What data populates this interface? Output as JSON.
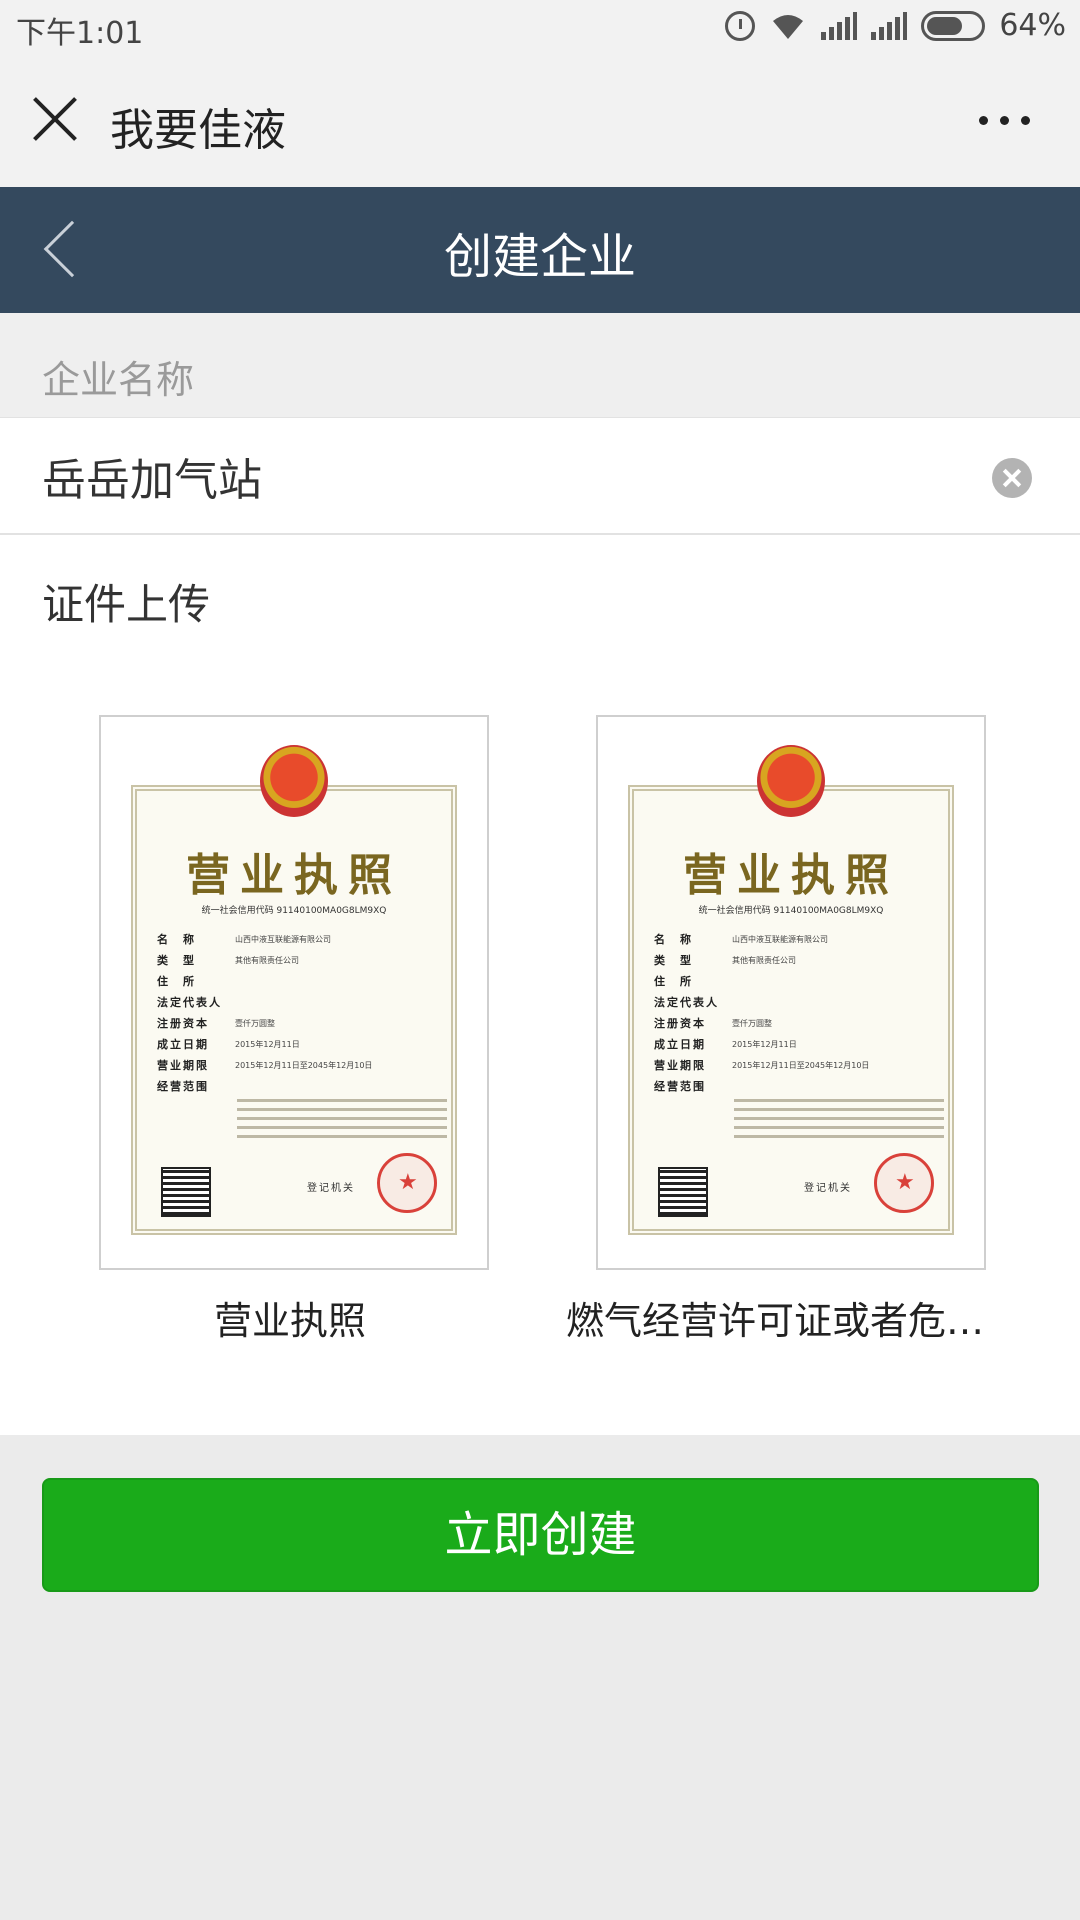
{
  "status_bar": {
    "time": "下午1:01",
    "battery": "64%",
    "icons": [
      "alarm-icon",
      "wifi-icon",
      "signal-icon",
      "signal-icon",
      "battery-icon"
    ]
  },
  "title_bar": {
    "title": "我要佳液",
    "close_icon": "close-icon",
    "more_icon": "more-icon"
  },
  "nav": {
    "title": "创建企业",
    "back_icon": "back-chevron-icon",
    "background": "#34495e"
  },
  "form": {
    "name_label": "企业名称",
    "name_value": "岳岳加气站",
    "clear_icon": "clear-icon",
    "upload_title": "证件上传"
  },
  "certificates": [
    {
      "caption": "营业执照",
      "doc": {
        "title": "营业执照",
        "code": "统一社会信用代码 91140100MA0G8LM9XQ",
        "rows": [
          {
            "k": "名　称",
            "v": "山西中液互联能源有限公司"
          },
          {
            "k": "类　型",
            "v": "其他有限责任公司"
          },
          {
            "k": "住　所",
            "v": ""
          },
          {
            "k": "法定代表人",
            "v": ""
          },
          {
            "k": "注册资本",
            "v": "壹仟万圆整"
          },
          {
            "k": "成立日期",
            "v": "2015年12月11日"
          },
          {
            "k": "营业期限",
            "v": "2015年12月11日至2045年12月10日"
          },
          {
            "k": "经营范围",
            "v": ""
          }
        ],
        "reg": "登记机关"
      }
    },
    {
      "caption": "燃气经营许可证或者危化...",
      "doc": {
        "title": "营业执照",
        "code": "统一社会信用代码 91140100MA0G8LM9XQ",
        "rows": [
          {
            "k": "名　称",
            "v": "山西中液互联能源有限公司"
          },
          {
            "k": "类　型",
            "v": "其他有限责任公司"
          },
          {
            "k": "住　所",
            "v": ""
          },
          {
            "k": "法定代表人",
            "v": ""
          },
          {
            "k": "注册资本",
            "v": "壹仟万圆整"
          },
          {
            "k": "成立日期",
            "v": "2015年12月11日"
          },
          {
            "k": "营业期限",
            "v": "2015年12月11日至2045年12月10日"
          },
          {
            "k": "经营范围",
            "v": ""
          }
        ],
        "reg": "登记机关"
      }
    }
  ],
  "submit": {
    "label": "立即创建",
    "color": "#1aab1a"
  }
}
